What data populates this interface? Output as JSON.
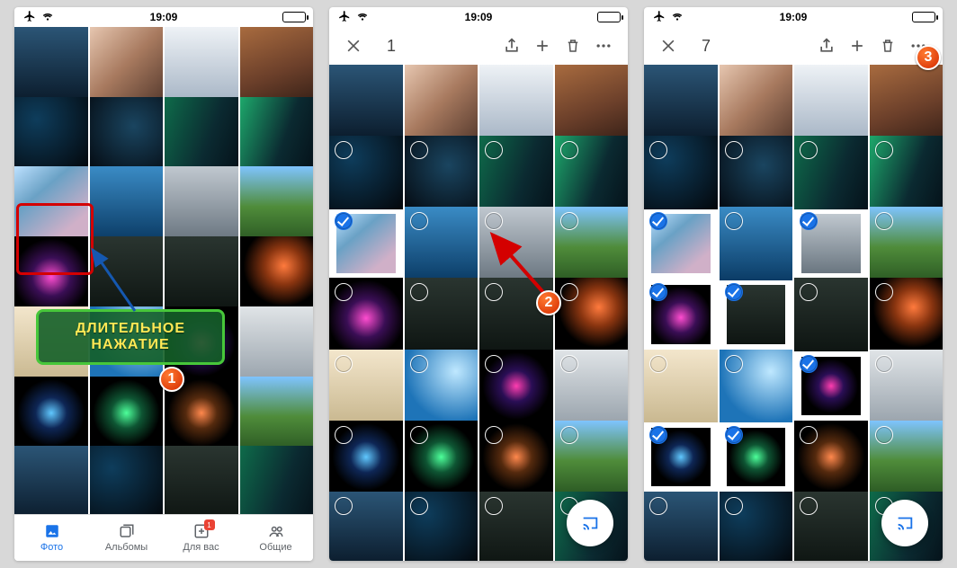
{
  "status": {
    "time": "19:09"
  },
  "phone1": {
    "tabs": [
      {
        "label": "Фото",
        "active": true
      },
      {
        "label": "Альбомы",
        "active": false
      },
      {
        "label": "Для вас",
        "active": false,
        "badge": "1"
      },
      {
        "label": "Общие",
        "active": false
      }
    ]
  },
  "phone2": {
    "selection_count": "1"
  },
  "phone3": {
    "selection_count": "7"
  },
  "callout": {
    "long_press": "ДЛИТЕЛЬНОЕ\nНАЖАТИЕ"
  },
  "badges": {
    "n1": "1",
    "n2": "2",
    "n3": "3"
  },
  "grid_rows": 7,
  "images": [
    "sky1",
    "peak",
    "clouds",
    "dune",
    "cosmos",
    "stars",
    "aurora",
    "aurora2",
    "mountain",
    "bluewater",
    "misty",
    "hills",
    "flower",
    "night",
    "night",
    "planet",
    "sand",
    "wave",
    "explode",
    "mist",
    "burst1",
    "burst2",
    "burst3",
    "hills",
    "sky1",
    "cosmos",
    "night",
    "aurora"
  ],
  "phone2_rings": {
    "startRow": 1,
    "checked": [
      8
    ]
  },
  "phone3_rings": {
    "startRow": 1,
    "checked": [
      8,
      10,
      12,
      13,
      18,
      20,
      21
    ]
  }
}
